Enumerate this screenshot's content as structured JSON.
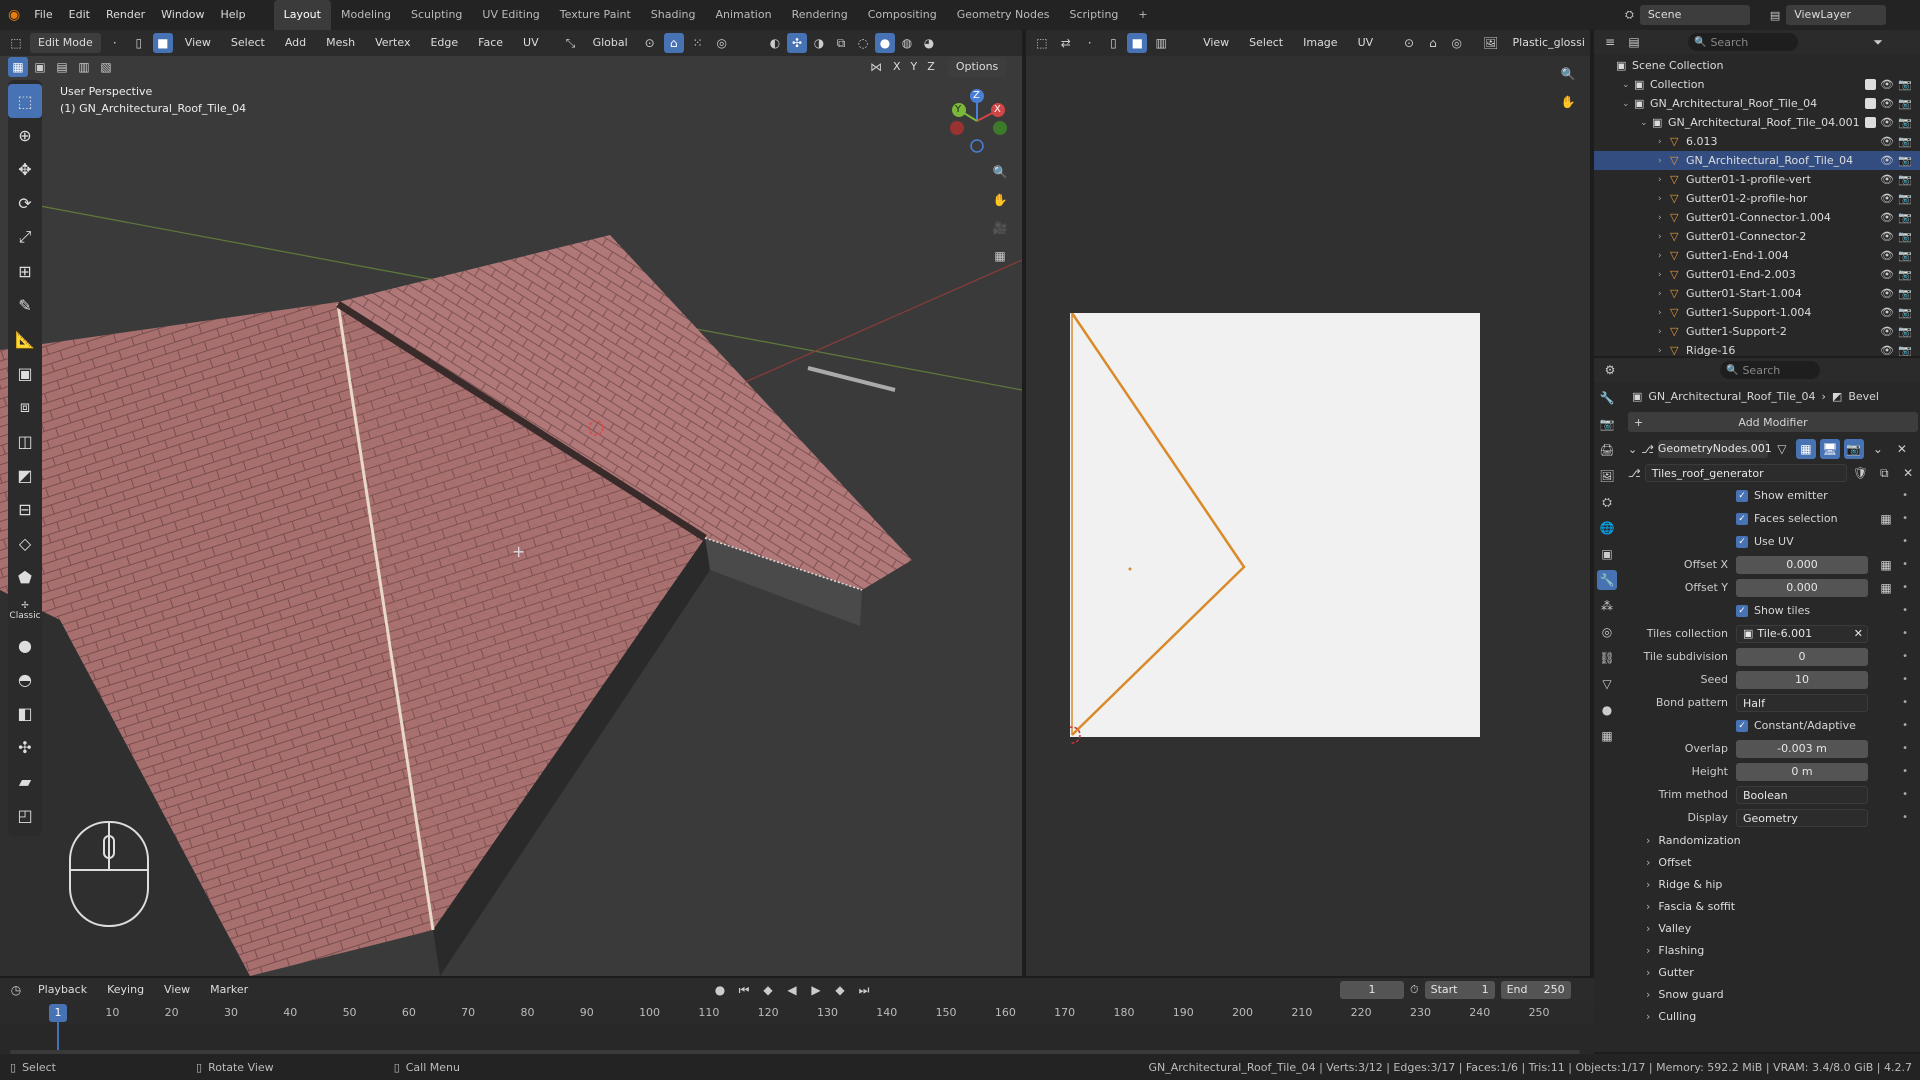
{
  "topmenu": {
    "items": [
      "File",
      "Edit",
      "Render",
      "Window",
      "Help"
    ]
  },
  "workspaces": [
    "Layout",
    "Modeling",
    "Sculpting",
    "UV Editing",
    "Texture Paint",
    "Shading",
    "Animation",
    "Rendering",
    "Compositing",
    "Geometry Nodes",
    "Scripting"
  ],
  "scene": {
    "label": "Scene",
    "viewlayer": "ViewLayer"
  },
  "viewport": {
    "mode": "Edit Mode",
    "menus": [
      "View",
      "Select",
      "Add",
      "Mesh",
      "Vertex",
      "Edge",
      "Face",
      "UV"
    ],
    "orientation": "Global",
    "options": "Options",
    "perspective": "User Perspective",
    "object_label": "(1) GN_Architectural_Roof_Tile_04",
    "axes": [
      "X",
      "Y",
      "Z"
    ],
    "gizmo": {
      "x": "X",
      "y": "Y",
      "z": "Z"
    },
    "tool_classic": "Classic"
  },
  "uv_editor": {
    "menus": [
      "View",
      "Select",
      "Image",
      "UV"
    ],
    "image_name": "Plastic_glossin"
  },
  "outliner": {
    "search_placeholder": "Search",
    "items": [
      {
        "label": "Scene Collection",
        "indent": 0
      },
      {
        "label": "Collection",
        "indent": 1
      },
      {
        "label": "GN_Architectural_Roof_Tile_04",
        "indent": 1
      },
      {
        "label": "GN_Architectural_Roof_Tile_04.001",
        "indent": 2
      },
      {
        "label": "6.013",
        "indent": 3
      },
      {
        "label": "GN_Architectural_Roof_Tile_04",
        "indent": 3,
        "selected": true
      },
      {
        "label": "Gutter01-1-profile-vert",
        "indent": 3
      },
      {
        "label": "Gutter01-2-profile-hor",
        "indent": 3
      },
      {
        "label": "Gutter01-Connector-1.004",
        "indent": 3
      },
      {
        "label": "Gutter01-Connector-2",
        "indent": 3
      },
      {
        "label": "Gutter1-End-1.004",
        "indent": 3
      },
      {
        "label": "Gutter01-End-2.003",
        "indent": 3
      },
      {
        "label": "Gutter01-Start-1.004",
        "indent": 3
      },
      {
        "label": "Gutter1-Support-1.004",
        "indent": 3
      },
      {
        "label": "Gutter1-Support-2",
        "indent": 3
      },
      {
        "label": "Ridge-16",
        "indent": 3
      }
    ]
  },
  "properties": {
    "search_placeholder": "Search",
    "breadcrumb_object": "GN_Architectural_Roof_Tile_04",
    "breadcrumb_modifier": "Bevel",
    "add_modifier": "Add Modifier",
    "modifier_name": "GeometryNodes.001",
    "node_group": "Tiles_roof_generator",
    "checks": {
      "show_emitter": "Show emitter",
      "faces_selection": "Faces selection",
      "use_uv": "Use UV",
      "show_tiles": "Show tiles",
      "constant_adaptive": "Constant/Adaptive"
    },
    "fields": {
      "offset_x_label": "Offset X",
      "offset_x": "0.000",
      "offset_y_label": "Offset Y",
      "offset_y": "0.000",
      "tiles_collection_label": "Tiles collection",
      "tiles_collection": "Tile-6.001",
      "tile_subdivision_label": "Tile subdivision",
      "tile_subdivision": "0",
      "seed_label": "Seed",
      "seed": "10",
      "bond_pattern_label": "Bond pattern",
      "bond_pattern": "Half",
      "overlap_label": "Overlap",
      "overlap": "-0.003 m",
      "height_label": "Height",
      "height": "0 m",
      "trim_method_label": "Trim method",
      "trim_method": "Boolean",
      "display_label": "Display",
      "display": "Geometry"
    },
    "panels": [
      "Randomization",
      "Offset",
      "Ridge & hip",
      "Fascia & soffit",
      "Valley",
      "Flashing",
      "Gutter",
      "Snow guard",
      "Culling"
    ]
  },
  "timeline": {
    "menus": [
      "Playback",
      "Keying",
      "View",
      "Marker"
    ],
    "current_frame": "1",
    "start_label": "Start",
    "start": "1",
    "end_label": "End",
    "end": "250",
    "ticks": [
      "1",
      "10",
      "20",
      "30",
      "40",
      "50",
      "60",
      "70",
      "80",
      "90",
      "100",
      "110",
      "120",
      "130",
      "140",
      "150",
      "160",
      "170",
      "180",
      "190",
      "200",
      "210",
      "220",
      "230",
      "240",
      "250"
    ]
  },
  "statusbar": {
    "select": "Select",
    "rotate": "Rotate View",
    "call_menu": "Call Menu",
    "stats": "GN_Architectural_Roof_Tile_04 | Verts:3/12 | Edges:3/17 | Faces:1/6 | Tris:11 | Objects:1/17 | Memory: 592.2 MiB | VRAM: 3.4/8.0 GiB | 4.2.7"
  },
  "colors": {
    "accent": "#4772b3",
    "roof": "#a86f6f",
    "uv_edge": "#d98a2b"
  }
}
